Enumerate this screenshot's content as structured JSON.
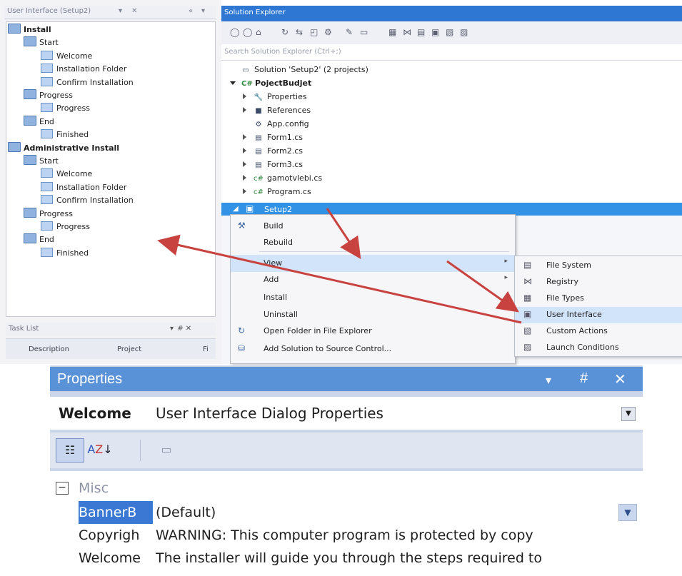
{
  "ui_panel": {
    "title": "User Interface (Setup2)",
    "title_controls": [
      "▾",
      "✕",
      "«",
      "▾"
    ],
    "tree": [
      {
        "label": "Install",
        "level": 0,
        "bold": true,
        "icon": "folder-icon"
      },
      {
        "label": "Start",
        "level": 1,
        "bold": false,
        "icon": "folder-icon"
      },
      {
        "label": "Welcome",
        "level": 2,
        "bold": false,
        "icon": "page-icon"
      },
      {
        "label": "Installation Folder",
        "level": 2,
        "bold": false,
        "icon": "page-icon"
      },
      {
        "label": "Confirm Installation",
        "level": 2,
        "bold": false,
        "icon": "page-icon"
      },
      {
        "label": "Progress",
        "level": 1,
        "bold": false,
        "icon": "folder-icon"
      },
      {
        "label": "Progress",
        "level": 2,
        "bold": false,
        "icon": "page-icon"
      },
      {
        "label": "End",
        "level": 1,
        "bold": false,
        "icon": "folder-icon"
      },
      {
        "label": "Finished",
        "level": 2,
        "bold": false,
        "icon": "page-icon"
      },
      {
        "label": "Administrative Install",
        "level": 0,
        "bold": true,
        "icon": "folder-icon"
      },
      {
        "label": "Start",
        "level": 1,
        "bold": false,
        "icon": "folder-icon"
      },
      {
        "label": "Welcome",
        "level": 2,
        "bold": false,
        "icon": "page-icon"
      },
      {
        "label": "Installation Folder",
        "level": 2,
        "bold": false,
        "icon": "page-icon"
      },
      {
        "label": "Confirm Installation",
        "level": 2,
        "bold": false,
        "icon": "page-icon"
      },
      {
        "label": "Progress",
        "level": 1,
        "bold": false,
        "icon": "folder-icon"
      },
      {
        "label": "Progress",
        "level": 2,
        "bold": false,
        "icon": "page-icon"
      },
      {
        "label": "End",
        "level": 1,
        "bold": false,
        "icon": "folder-icon"
      },
      {
        "label": "Finished",
        "level": 2,
        "bold": false,
        "icon": "page-icon"
      }
    ]
  },
  "task_list": {
    "title": "Task List",
    "controls": "▾  # ✕",
    "columns": [
      "Description",
      "Project",
      "Fi"
    ]
  },
  "solution_explorer": {
    "title": "Solution Explorer",
    "search_placeholder": "Search Solution Explorer (Ctrl+;)",
    "toolbar_icons": [
      "back-icon",
      "forward-icon",
      "home-icon",
      "sync-icon",
      "refresh-icon",
      "collapse-icon",
      "properties-icon",
      "pin-icon",
      "view-icon",
      "file-system-icon",
      "registry-icon",
      "file-types-icon",
      "user-interface-icon",
      "custom-actions-icon",
      "launch-conditions-icon"
    ],
    "tree": [
      {
        "label": "Solution 'Setup2' (2 projects)",
        "level": 0,
        "expander": "none",
        "icon": "solution-icon",
        "bold": false
      },
      {
        "label": "PojectBudjet",
        "level": 0,
        "expander": "expanded",
        "icon": "csharp-project-icon",
        "bold": true
      },
      {
        "label": "Properties",
        "level": 1,
        "expander": "collapsed",
        "icon": "wrench-icon",
        "bold": false
      },
      {
        "label": "References",
        "level": 1,
        "expander": "collapsed",
        "icon": "references-icon",
        "bold": false
      },
      {
        "label": "App.config",
        "level": 1,
        "expander": "none",
        "icon": "config-icon",
        "bold": false
      },
      {
        "label": "Form1.cs",
        "level": 1,
        "expander": "collapsed",
        "icon": "form-icon",
        "bold": false
      },
      {
        "label": "Form2.cs",
        "level": 1,
        "expander": "collapsed",
        "icon": "form-icon",
        "bold": false
      },
      {
        "label": "Form3.cs",
        "level": 1,
        "expander": "collapsed",
        "icon": "form-icon",
        "bold": false
      },
      {
        "label": "gamotvlebi.cs",
        "level": 1,
        "expander": "collapsed",
        "icon": "csharp-file-icon",
        "bold": false
      },
      {
        "label": "Program.cs",
        "level": 1,
        "expander": "collapsed",
        "icon": "csharp-file-icon",
        "bold": false
      }
    ],
    "selected": {
      "label": "Setup2",
      "icon": "setup-project-icon"
    }
  },
  "context_menu": {
    "items": [
      {
        "label": "Build",
        "icon": "build-icon",
        "submenu": false,
        "highlighted": false
      },
      {
        "label": "Rebuild",
        "icon": "",
        "submenu": false,
        "highlighted": false
      },
      {
        "label": "View",
        "icon": "",
        "submenu": true,
        "highlighted": true
      },
      {
        "label": "Add",
        "icon": "",
        "submenu": true,
        "highlighted": false
      },
      {
        "label": "Install",
        "icon": "",
        "submenu": false,
        "highlighted": false
      },
      {
        "label": "Uninstall",
        "icon": "",
        "submenu": false,
        "highlighted": false
      },
      {
        "label": "Open Folder in File Explorer",
        "icon": "open-folder-icon",
        "submenu": false,
        "highlighted": false
      },
      {
        "label": "Add Solution to Source Control...",
        "icon": "source-control-icon",
        "submenu": false,
        "highlighted": false
      }
    ],
    "submenu_items": [
      {
        "label": "File System",
        "icon": "file-system-icon",
        "highlighted": false
      },
      {
        "label": "Registry",
        "icon": "registry-icon",
        "highlighted": false
      },
      {
        "label": "File Types",
        "icon": "file-types-icon",
        "highlighted": false
      },
      {
        "label": "User Interface",
        "icon": "user-interface-icon",
        "highlighted": true
      },
      {
        "label": "Custom Actions",
        "icon": "custom-actions-icon",
        "highlighted": false
      },
      {
        "label": "Launch Conditions",
        "icon": "launch-conditions-icon",
        "highlighted": false
      }
    ]
  },
  "properties": {
    "title": "Properties",
    "title_controls": [
      "▾",
      "#",
      "✕"
    ],
    "object_name": "Welcome",
    "object_type": "User Interface Dialog Properties",
    "category": "Misc",
    "rows": [
      {
        "key": "BannerB",
        "value": "(Default)",
        "selected": true
      },
      {
        "key": "Copyrigh",
        "value": "WARNING: This computer program is protected by copy",
        "selected": false
      },
      {
        "key": "Welcome",
        "value": "The installer will guide you through the steps required to",
        "selected": false
      }
    ]
  },
  "colors": {
    "accent": "#2e78d4",
    "selection": "#3192e6",
    "annotation_arrow": "#c8423f",
    "properties_title": "#5a92d8"
  }
}
